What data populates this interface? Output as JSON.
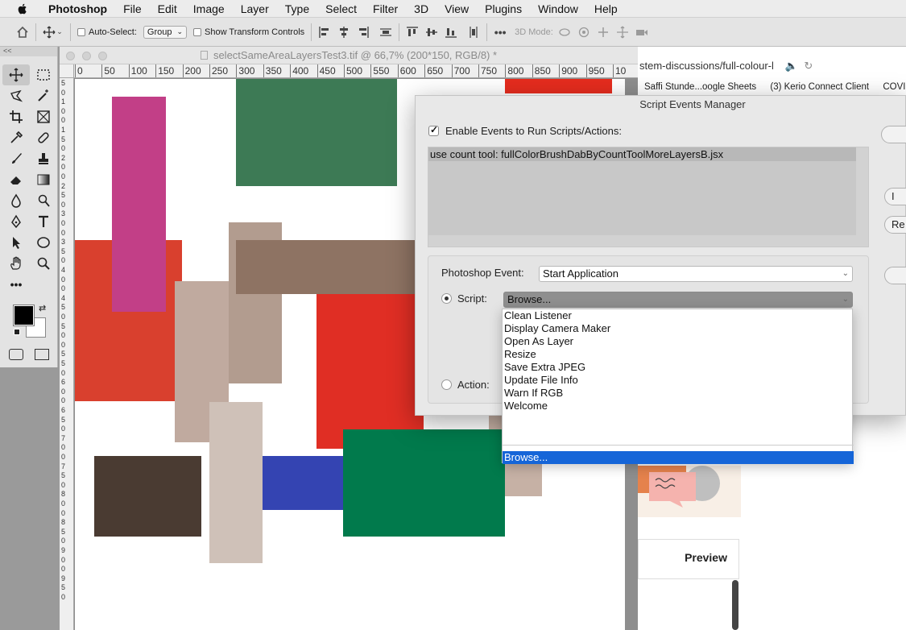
{
  "menubar": {
    "app_name": "Photoshop",
    "items": [
      "File",
      "Edit",
      "Image",
      "Layer",
      "Type",
      "Select",
      "Filter",
      "3D",
      "View",
      "Plugins",
      "Window",
      "Help"
    ]
  },
  "options_bar": {
    "auto_select_label": "Auto-Select:",
    "auto_select_value": "Group",
    "show_transform_label": "Show Transform Controls",
    "mode_3d_label": "3D Mode:"
  },
  "tools_panel": {
    "collapse_glyph": "<<",
    "foreground_color": "#000000",
    "background_color": "#ffffff"
  },
  "document": {
    "title": "selectSameAreaLayersTest3.tif @ 66,7% (200*150, RGB/8) *",
    "ruler_ticks": [
      "0",
      "50",
      "100",
      "150",
      "200",
      "250",
      "300",
      "350",
      "400",
      "450",
      "500",
      "550",
      "600",
      "650",
      "700",
      "750",
      "800",
      "850",
      "900",
      "950",
      "10"
    ],
    "left_ruler_digits": [
      "5",
      "0",
      "1",
      "0",
      "0",
      "1",
      "5",
      "0",
      "2",
      "0",
      "0",
      "2",
      "5",
      "0",
      "3",
      "0",
      "0",
      "3",
      "5",
      "0",
      "4",
      "0",
      "0",
      "4",
      "5",
      "0",
      "5",
      "0",
      "0",
      "5",
      "5",
      "0",
      "6",
      "0",
      "0",
      "6",
      "5",
      "0",
      "7",
      "0",
      "0",
      "7",
      "5",
      "0",
      "8",
      "0",
      "0",
      "8",
      "5",
      "0",
      "9",
      "0",
      "0",
      "9",
      "5",
      "0"
    ]
  },
  "browser": {
    "url_text": "stem-discussions/full-colour-l",
    "bookmarks": [
      "Saffi Stunde...oogle Sheets",
      "(3) Kerio Connect Client",
      "COVID"
    ],
    "preview_label": "Preview",
    "side_buttons": [
      "I",
      "Re"
    ]
  },
  "dialog": {
    "title": "Script Events Manager",
    "enable_label": "Enable Events to Run Scripts/Actions:",
    "enable_checked": true,
    "events": [
      "use count tool: fullColorBrushDabByCountToolMoreLayersB.jsx"
    ],
    "photoshop_event_label": "Photoshop Event:",
    "photoshop_event_value": "Start Application",
    "script_label": "Script:",
    "script_value": "Browse...",
    "action_label": "Action:"
  },
  "script_dropdown": {
    "options": [
      "Clean Listener",
      "Display Camera Maker",
      "Open As Layer",
      "Resize",
      "Save Extra JPEG",
      "Update File Info",
      "Warn If RGB",
      "Welcome"
    ],
    "browse_option": "Browse..."
  }
}
